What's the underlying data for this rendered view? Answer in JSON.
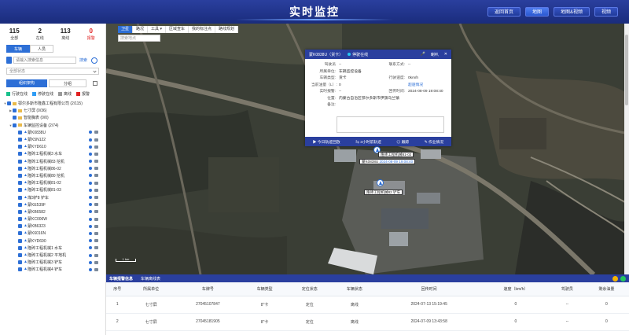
{
  "header": {
    "title": "实时监控",
    "nav": [
      "返回首页",
      "地图",
      "地图&视频",
      "视频"
    ],
    "active_nav": 1
  },
  "sidebar": {
    "stats": [
      {
        "num": "115",
        "label": "全部"
      },
      {
        "num": "2",
        "label": "在线"
      },
      {
        "num": "113",
        "label": "离线"
      },
      {
        "num": "0",
        "label": "报警",
        "red": true
      }
    ],
    "tabs": [
      "车辆",
      "人员"
    ],
    "search_placeholder": "请输入搜索信息",
    "search_btn": "搜索",
    "status_placeholder": "全部状态",
    "group_btn": "组织架构",
    "group_btn2": "分组",
    "legend": [
      {
        "label": "行驶在线",
        "color": "#18c08b"
      },
      {
        "label": "停驶在线",
        "color": "#2d9cf5"
      },
      {
        "label": "离线",
        "color": "#999999"
      },
      {
        "label": "报警",
        "color": "#e02020"
      }
    ],
    "tree": [
      {
        "indent": 0,
        "caret": "▼",
        "folder": true,
        "label": "鄂尔多斯市隆鑫工程有限公司 (2/115)"
      },
      {
        "indent": 1,
        "caret": "▶",
        "folder": true,
        "label": "七寸屏 (0/36)"
      },
      {
        "indent": 1,
        "caret": "",
        "folder": true,
        "label": "智能胸表 (0/0)"
      },
      {
        "indent": 1,
        "caret": "▼",
        "folder": true,
        "label": "车辆监控设备 (2/74)"
      },
      {
        "indent": 2,
        "vehicle": true,
        "label": "蒙K0838U"
      },
      {
        "indent": 2,
        "vehicle": true,
        "label": "蒙K5N122"
      },
      {
        "indent": 2,
        "vehicle": true,
        "label": "蒙KYD610"
      },
      {
        "indent": 2,
        "vehicle": true,
        "label": "隆砖工程机械3 水车"
      },
      {
        "indent": 2,
        "vehicle": true,
        "label": "隆砖工程机械83 挖机"
      },
      {
        "indent": 2,
        "vehicle": true,
        "label": "隆砖工程机械86-02"
      },
      {
        "indent": 2,
        "vehicle": true,
        "label": "隆砖工程机械80 挖机"
      },
      {
        "indent": 2,
        "vehicle": true,
        "label": "隆砖工程机械81-02"
      },
      {
        "indent": 2,
        "vehicle": true,
        "label": "隆砖工程机械81-03"
      },
      {
        "indent": 2,
        "vehicle": true,
        "label": "煤3铲8 铲车"
      },
      {
        "indent": 2,
        "vehicle": true,
        "label": "蒙KE539F"
      },
      {
        "indent": 2,
        "vehicle": true,
        "label": "蒙KB6582"
      },
      {
        "indent": 2,
        "vehicle": true,
        "label": "蒙KC006W"
      },
      {
        "indent": 2,
        "vehicle": true,
        "label": "蒙KB6323"
      },
      {
        "indent": 2,
        "vehicle": true,
        "label": "蒙K6016N"
      },
      {
        "indent": 2,
        "vehicle": true,
        "label": "蒙KYD690"
      },
      {
        "indent": 2,
        "vehicle": true,
        "label": "隆砖工程机械1 水车"
      },
      {
        "indent": 2,
        "vehicle": true,
        "label": "隆砖工程机械2 平地机"
      },
      {
        "indent": 2,
        "vehicle": true,
        "label": "隆砖工程机械3 铲车"
      },
      {
        "indent": 2,
        "vehicle": true,
        "label": "隆砖工程机械4 铲车"
      }
    ]
  },
  "map": {
    "tools": [
      "卫星",
      "路况",
      "工具",
      "区域查车",
      "我的标注点",
      "路线规划"
    ],
    "search_placeholder": "搜索地点",
    "scale": "1 km",
    "markers": [
      {
        "label": "蒙K0838U",
        "sub": "2024-08-09 19:08:40"
      },
      {
        "label": "隆砖工程机械81-02"
      },
      {
        "label": "隆砖工程机械82 铲车"
      }
    ]
  },
  "popup": {
    "plate": "蒙K0838U（货卡）",
    "status": "停驶在线",
    "tools": [
      "🎤",
      "喇叭",
      "✕"
    ],
    "rows": [
      {
        "k": "驾驶员",
        "v": "--",
        "k2": "联系方式:",
        "v2": "--"
      },
      {
        "k": "所属单位:",
        "v": "车辆监控设备",
        "k2": "",
        "v2": ""
      },
      {
        "k": "车辆类型:",
        "v": "货卡",
        "k2": "行驶速度:",
        "v2": "0km/h"
      },
      {
        "k": "当前油量（L）:",
        "v": "0",
        "k2": "",
        "v2": "超速情况",
        "v2link": true
      },
      {
        "k": "实时报警:",
        "v": "--",
        "k2": "回传时间:",
        "v2": "2024-08-09 19:08:40"
      }
    ],
    "address_label": "位置:",
    "address": "内蒙古自治区鄂尔多斯市伊旗乌兰镇",
    "remark_label": "备注:",
    "footer": [
      "今日轨迹回放",
      "3小时前轨迹",
      "跟踪",
      "作业情况"
    ]
  },
  "bottom": {
    "tabs": [
      "车辆报警信息",
      "车辆离线表"
    ],
    "columns": [
      "序号",
      "所属单位",
      "车牌号",
      "车辆类型",
      "定位状态",
      "车辆状态",
      "回传时间",
      "速度（km/h）",
      "驾驶员",
      "剩余油量"
    ],
    "rows": [
      [
        "1",
        "七寸屏",
        "27045107847",
        "8\"卡",
        "定位",
        "离线",
        "2024-07-13 15:19:45",
        "0",
        "--",
        "0"
      ],
      [
        "2",
        "七寸屏",
        "27045181905",
        "8\"卡",
        "定位",
        "离线",
        "2024-07-09 13:43:58",
        "0",
        "--",
        "0"
      ]
    ]
  }
}
